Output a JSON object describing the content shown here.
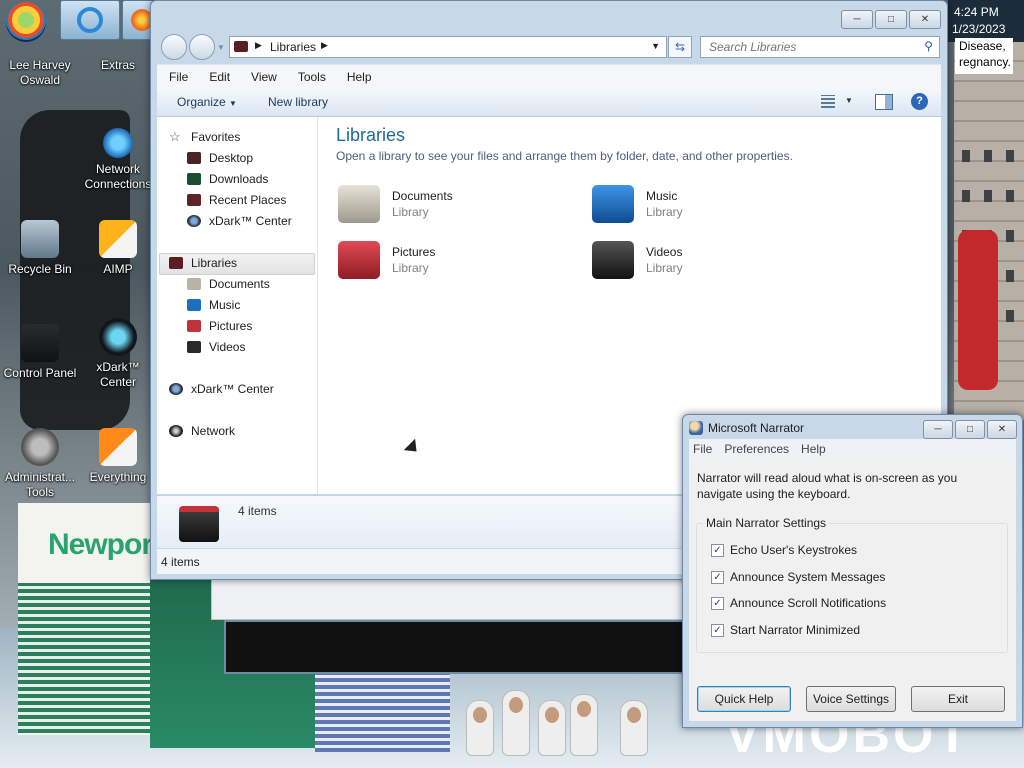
{
  "taskbar": {
    "time": "4:24 PM",
    "date": "1/23/2023"
  },
  "sticky_note": {
    "lines": [
      "Disease,",
      "regnancy."
    ]
  },
  "desktop_icons": [
    {
      "label": "Lee Harvey Oswald"
    },
    {
      "label": "Extras"
    },
    {
      "label": "Network Connections"
    },
    {
      "label": "Recycle Bin"
    },
    {
      "label": "AIMP"
    },
    {
      "label": "Control Panel"
    },
    {
      "label": "xDark™ Center"
    },
    {
      "label": "Administrat... Tools"
    },
    {
      "label": "Everything"
    }
  ],
  "wallpaper": {
    "brand": "Newport",
    "watermark": "VMOBOT"
  },
  "explorer": {
    "address": "Libraries",
    "search_placeholder": "Search Libraries",
    "menu": [
      "File",
      "Edit",
      "View",
      "Tools",
      "Help"
    ],
    "commands": {
      "organize": "Organize",
      "new_library": "New library"
    },
    "nav": {
      "favorites": "Favorites",
      "favorites_items": [
        "Desktop",
        "Downloads",
        "Recent Places",
        "xDark™ Center"
      ],
      "libraries": "Libraries",
      "libraries_items": [
        "Documents",
        "Music",
        "Pictures",
        "Videos"
      ],
      "xdark": "xDark™ Center",
      "network": "Network"
    },
    "content": {
      "title": "Libraries",
      "subtitle": "Open a library to see your files and arrange them by folder, date, and other properties.",
      "libraries": [
        {
          "name": "Documents",
          "type": "Library",
          "color": "#b9b2a6"
        },
        {
          "name": "Music",
          "type": "Library",
          "color": "#1f6fc0"
        },
        {
          "name": "Pictures",
          "type": "Library",
          "color": "#c2323a"
        },
        {
          "name": "Videos",
          "type": "Library",
          "color": "#2a2a2a"
        }
      ]
    },
    "details_count": "4 items",
    "status_count": "4 items"
  },
  "narrator": {
    "title": "Microsoft Narrator",
    "menu": [
      "File",
      "Preferences",
      "Help"
    ],
    "description": "Narrator will read aloud what is on-screen as you navigate using the keyboard.",
    "group_label": "Main Narrator Settings",
    "options": [
      {
        "label": "Echo User's Keystrokes",
        "checked": true
      },
      {
        "label": "Announce System Messages",
        "checked": true
      },
      {
        "label": "Announce Scroll Notifications",
        "checked": true
      },
      {
        "label": "Start Narrator Minimized",
        "checked": true
      }
    ],
    "buttons": {
      "quick_help": "Quick Help",
      "voice_settings": "Voice Settings",
      "exit": "Exit"
    }
  }
}
